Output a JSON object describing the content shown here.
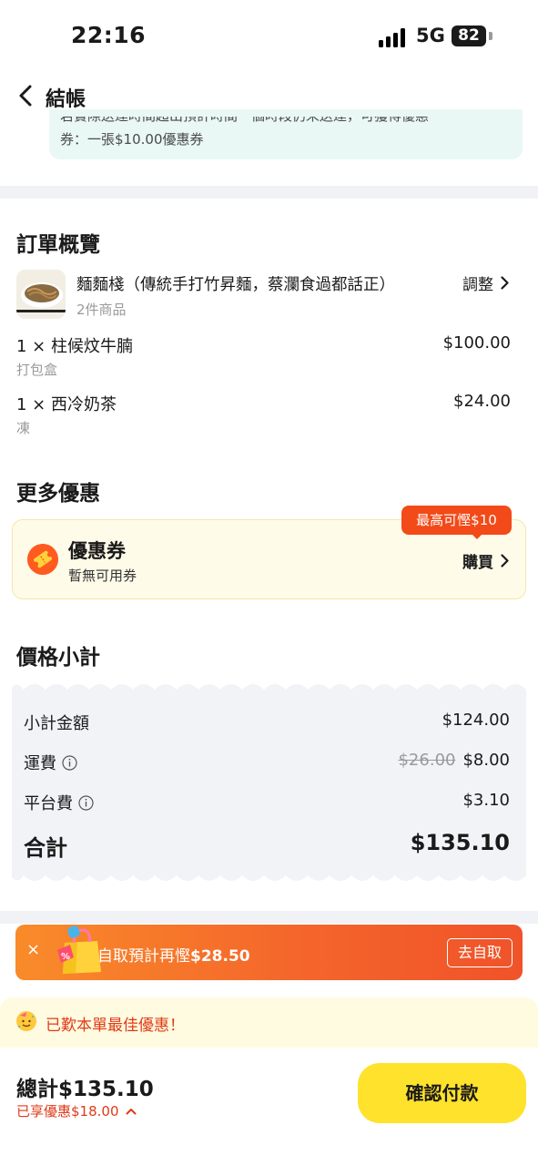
{
  "status_bar": {
    "time": "22:16",
    "network": "5G",
    "battery": "82"
  },
  "header": {
    "title": "結帳"
  },
  "notice": {
    "line1": "若實際送達時間超出預計時間一個時段仍未送達，可獲得優惠",
    "line2": "券：一張$10.00優惠券"
  },
  "order_summary": {
    "title": "訂單概覽",
    "store_name": "麵麵棧（傳統手打竹昇麵，蔡瀾食過都話正）",
    "store_count": "2件商品",
    "adjust_label": "調整",
    "items": [
      {
        "name": "1 × 柱候炆牛腩",
        "price": "$100.00",
        "note": "打包盒"
      },
      {
        "name": "1 × 西冷奶茶",
        "price": "$24.00",
        "note": "凍"
      }
    ]
  },
  "more_offers": {
    "title": "更多優惠",
    "coupon_title": "優惠券",
    "coupon_sub": "暫無可用券",
    "buy_label": "購買",
    "badge": "最高可慳$10"
  },
  "price_summary": {
    "title": "價格小計",
    "subtotal_label": "小計金額",
    "subtotal_value": "$124.00",
    "delivery_label": "運費",
    "delivery_original": "$26.00",
    "delivery_value": "$8.00",
    "platform_label": "平台費",
    "platform_value": "$3.10",
    "total_label": "合計",
    "total_value": "$135.10"
  },
  "pickup_banner": {
    "close": "×",
    "text_prefix": "自取預計再慳",
    "text_amount": "$28.50",
    "button": "去自取"
  },
  "best_deal": {
    "text": "已歎本單最佳優惠！"
  },
  "bottom_bar": {
    "grand_total": "總計$135.10",
    "savings": "已享優惠$18.00",
    "pay_button": "確認付款"
  },
  "colors": {
    "accent_yellow": "#ffe22b",
    "accent_orange": "#f24a18",
    "discount_red": "#e03a18",
    "notice_bg": "#e9f8f5",
    "coupon_bg": "#fffbe9"
  }
}
